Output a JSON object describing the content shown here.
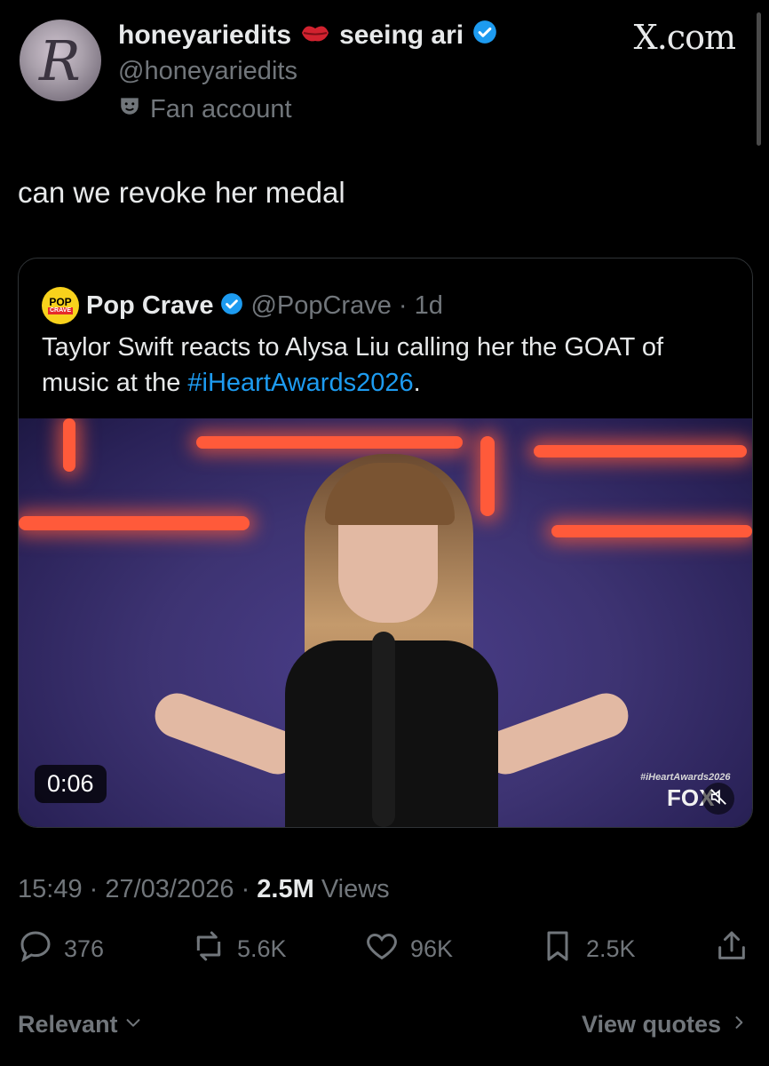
{
  "author": {
    "display_name": "honeyariedits",
    "name_suffix": "seeing ari",
    "handle": "@honeyariedits",
    "label": "Fan account"
  },
  "brand": "X.com",
  "tweet_text": "can we revoke her medal",
  "quote": {
    "logo_top": "POP",
    "logo_bottom": "CRAVE",
    "name": "Pop Crave",
    "handle": "@PopCrave",
    "time": "· 1d",
    "text_before": "Taylor Swift reacts to Alysa Liu calling her the GOAT of music at the ",
    "hashtag": "#iHeartAwards2026",
    "text_after": ".",
    "video_duration": "0:06",
    "video_watermark": "#iHeartAwards2026",
    "video_network": "FOX"
  },
  "meta": {
    "time": "15:49",
    "date": "27/03/2026",
    "views_count": "2.5M",
    "views_label": "Views"
  },
  "actions": {
    "replies": "376",
    "reposts": "5.6K",
    "likes": "96K",
    "bookmarks": "2.5K"
  },
  "footer": {
    "sort_label": "Relevant",
    "view_quotes": "View quotes"
  },
  "colors": {
    "accent": "#1d9bf0",
    "muted": "#71767b",
    "text": "#e7e9ea",
    "background": "#000000"
  }
}
